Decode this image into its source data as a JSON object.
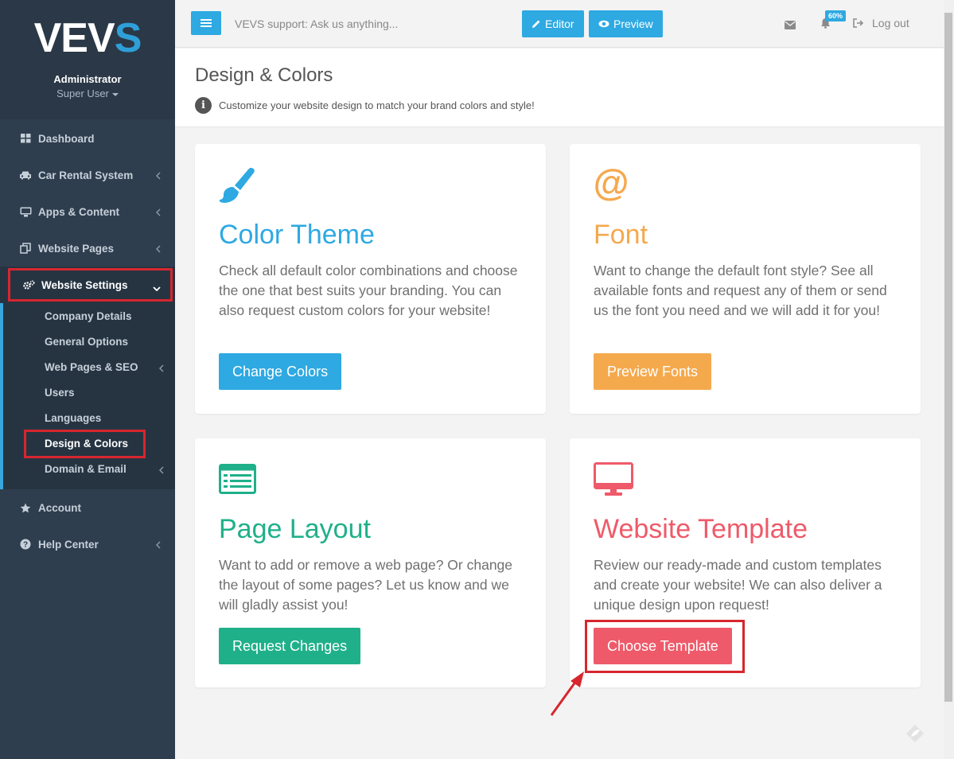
{
  "brand": {
    "logo_main": "VEV",
    "logo_accent": "S",
    "admin_name": "Administrator",
    "admin_role": "Super User"
  },
  "sidebar": {
    "items": [
      {
        "label": "Dashboard"
      },
      {
        "label": "Car Rental System"
      },
      {
        "label": "Apps & Content"
      },
      {
        "label": "Website Pages"
      },
      {
        "label": "Website Settings"
      },
      {
        "label": "Account"
      },
      {
        "label": "Help Center"
      }
    ],
    "sub_items": [
      {
        "label": "Company Details"
      },
      {
        "label": "General Options"
      },
      {
        "label": "Web Pages & SEO"
      },
      {
        "label": "Users"
      },
      {
        "label": "Languages"
      },
      {
        "label": "Design & Colors"
      },
      {
        "label": "Domain & Email"
      }
    ]
  },
  "topbar": {
    "support_text": "VEVS support: Ask us anything...",
    "editor_label": "Editor",
    "preview_label": "Preview",
    "notification_badge": "60%",
    "logout_label": "Log out"
  },
  "page": {
    "title": "Design & Colors",
    "subtitle": "Customize your website design to match your brand colors and style!"
  },
  "cards": [
    {
      "title": "Color Theme",
      "desc": "Check all default color combinations and choose the one that best suits your branding. You can also request custom colors for your website!",
      "button": "Change Colors",
      "color": "#2ea9e2",
      "icon": "paintbrush-icon"
    },
    {
      "title": "Font",
      "desc": "Want to change the default font style? See all available fonts and request any of them or send us the font you need and we will add it for you!",
      "button": "Preview Fonts",
      "color": "#f5a94d",
      "icon": "at-sign-icon"
    },
    {
      "title": "Page Layout",
      "desc": "Want to add or remove a web page? Or change the layout of some pages? Let us know and we will gladly assist you!",
      "button": "Request Changes",
      "color": "#1fb08a",
      "icon": "list-layout-icon"
    },
    {
      "title": "Website Template",
      "desc": "Review our ready-made and custom templates and create your website! We can also deliver a unique design upon request!",
      "button": "Choose Template",
      "color": "#ee5a6a",
      "icon": "monitor-icon"
    }
  ],
  "colors": {
    "sidebar_bg": "#2f3e4e",
    "accent": "#2ea9e2",
    "highlight": "#d7262e"
  }
}
